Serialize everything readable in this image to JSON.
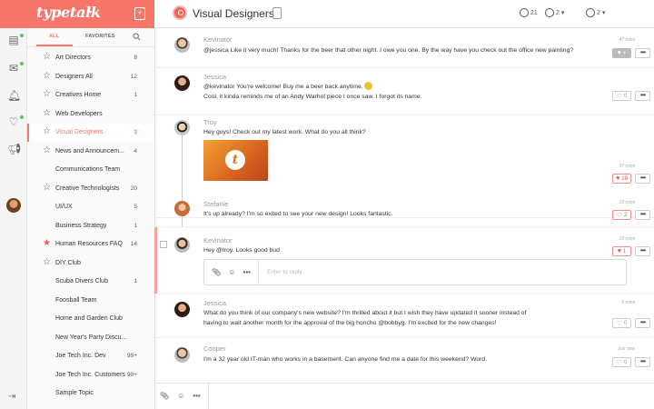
{
  "app": {
    "logo_text": "typetalk"
  },
  "header": {
    "topic_title": "Visual Designers",
    "members_count": "21",
    "time_count": "2",
    "notif_count": "2",
    "caret": "▾"
  },
  "sidebar": {
    "tab_all": "ALL",
    "tab_favorites": "FAVORITES",
    "items": [
      {
        "name": "Art Directors",
        "count": "8",
        "star": true
      },
      {
        "name": "Designers All",
        "count": "12",
        "star": true
      },
      {
        "name": "Creatives Home",
        "count": "1",
        "star": true
      },
      {
        "name": "Web Developers",
        "count": "",
        "star": true
      },
      {
        "name": "Visual Designers",
        "count": "3",
        "star": true,
        "active": true
      },
      {
        "name": "News and Announcem...",
        "count": "4",
        "star": true
      },
      {
        "name": "Communications Team",
        "count": "",
        "star": false
      },
      {
        "name": "Creative Technologists",
        "count": "20",
        "star": true
      },
      {
        "name": "UI/UX",
        "count": "5",
        "star": false
      },
      {
        "name": "Business Strategy",
        "count": "1",
        "star": false
      },
      {
        "name": "Human Resources FAQ",
        "count": "14",
        "star": true,
        "redstar": true
      },
      {
        "name": "DIY Club",
        "count": "",
        "star": true
      },
      {
        "name": "Scuba Divers Club",
        "count": "1",
        "star": false
      },
      {
        "name": "Foosball Team",
        "count": "",
        "star": false
      },
      {
        "name": "Home and Garden Club",
        "count": "",
        "star": false
      },
      {
        "name": "New Year's Party Discu...",
        "count": "",
        "star": false
      },
      {
        "name": "Joe Tech Inc. Dev",
        "count": "99+",
        "star": false
      },
      {
        "name": "Joe Tech Inc. Customers",
        "count": "99+",
        "star": false
      },
      {
        "name": "Sample Topic",
        "count": "",
        "star": false
      }
    ]
  },
  "messages": [
    {
      "author": "Kevinator",
      "text": "@jessica Like it very much! Thanks for the beer that other night. I owe you one. By the way have you check out the office new painting?",
      "time": "47 mins",
      "likes": "+"
    },
    {
      "author": "Jessica",
      "text": "@kevinator You're welcome! Buy me a beer back anytime.",
      "text2": "Cool, it kinda reminds me of an Andy Warhol piece I once saw. I forgot its name.",
      "time": "",
      "likes": "0"
    },
    {
      "author": "Troy",
      "text": "Hey guys! Check out my latest work. What do you all think?",
      "time": "37 mins",
      "likes": "19"
    },
    {
      "author": "Stefanie",
      "text": "It's up already? I'm so exited to see your new design! Looks fantastic.",
      "time": "10 mins",
      "likes": "2"
    },
    {
      "author": "Kevinator",
      "text": "Hey @troy. Looks good bud",
      "time": "10 mins",
      "likes": "1"
    },
    {
      "author": "Jessica",
      "text": "What do you think of our company's new website? I'm thrilled about it but I wish they have updated it sooner instead of having to wait another month for the approval of the big honcho @bobbyg. I'm excited for the new changes!",
      "time": "5 mins",
      "likes": "0"
    },
    {
      "author": "Cooper",
      "text": "I'm a 32 year old IT-man who works in a basement. Can anyone find me a date for this weekend? Word.",
      "time": "just now",
      "likes": "0"
    }
  ],
  "reply": {
    "placeholder": "Enter to reply"
  },
  "image_logo_letter": "t"
}
